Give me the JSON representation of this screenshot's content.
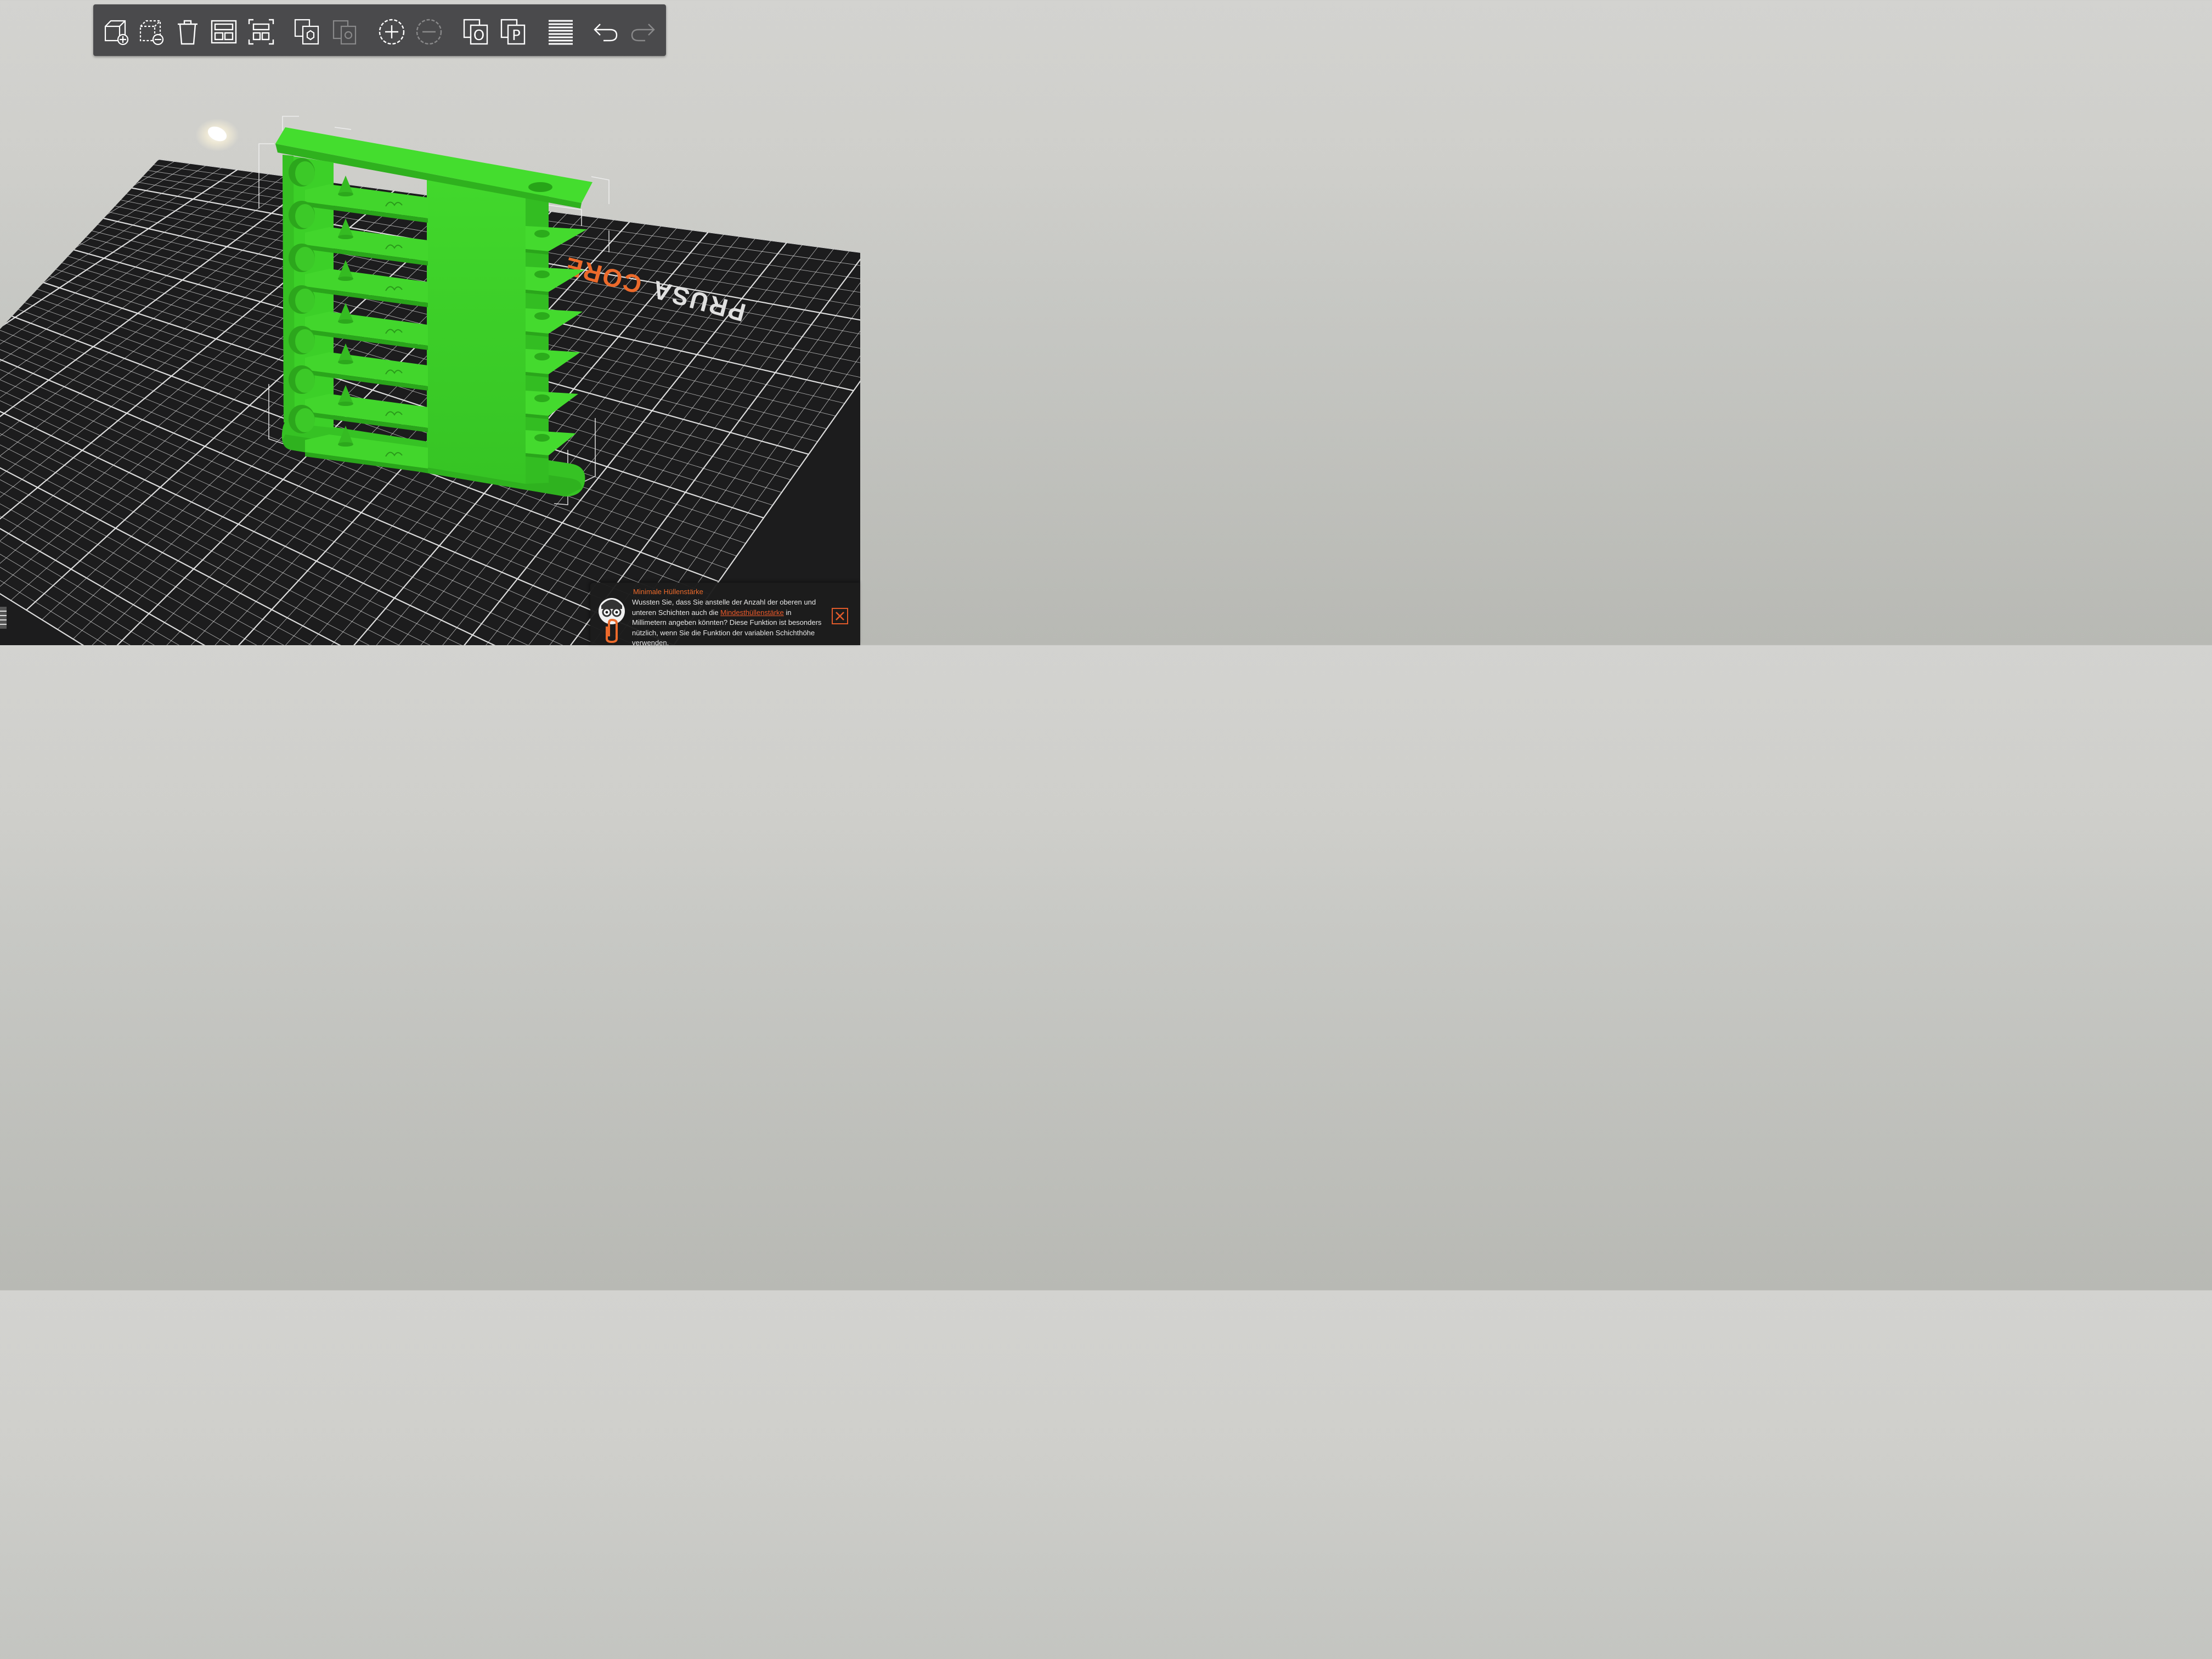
{
  "toolbar": {
    "buttons": [
      {
        "name": "add-object-button",
        "icon": "add-cube-icon",
        "enabled": true
      },
      {
        "name": "delete-object-button",
        "icon": "remove-cube-icon",
        "enabled": true
      },
      {
        "name": "delete-all-button",
        "icon": "trash-icon",
        "enabled": true
      },
      {
        "name": "arrange-button",
        "icon": "arrange-icon",
        "enabled": true
      },
      {
        "name": "arrange-selection-button",
        "icon": "arrange-selection-icon",
        "enabled": true
      },
      {
        "name": "copy-button",
        "icon": "copy-icon",
        "enabled": true
      },
      {
        "name": "paste-button",
        "icon": "paste-icon",
        "enabled": false
      },
      {
        "name": "add-instance-button",
        "icon": "plus-circle-icon",
        "enabled": true
      },
      {
        "name": "remove-instance-button",
        "icon": "minus-circle-icon",
        "enabled": false
      },
      {
        "name": "split-to-objects-button",
        "icon": "split-objects-icon",
        "label": "O",
        "enabled": true
      },
      {
        "name": "split-to-parts-button",
        "icon": "split-parts-icon",
        "label": "P",
        "enabled": true
      },
      {
        "name": "variable-layer-height-button",
        "icon": "layers-icon",
        "enabled": true
      },
      {
        "name": "undo-button",
        "icon": "undo-icon",
        "enabled": true
      },
      {
        "name": "redo-button",
        "icon": "redo-icon",
        "enabled": false
      }
    ]
  },
  "bed": {
    "logo_text": "PRUSA",
    "logo_accent_text": "CORE"
  },
  "hint": {
    "title": "Minimale Hüllenstärke",
    "text_before": "Wussten Sie, dass Sie anstelle der Anzahl der oberen und unteren Schichten auch die ",
    "link": "Mindesthüllenstärke",
    "text_after": " in Millimetern angeben könnten? Diese Funktion ist besonders nützlich, wenn Sie die Funktion der variablen Schichthöhe verwenden."
  },
  "colors": {
    "model": "#3fd629",
    "bed": "#1c1c1d",
    "grid": "#e8e8e8",
    "accent": "#ec6a2b",
    "toolbar": "#4a4a4c"
  }
}
